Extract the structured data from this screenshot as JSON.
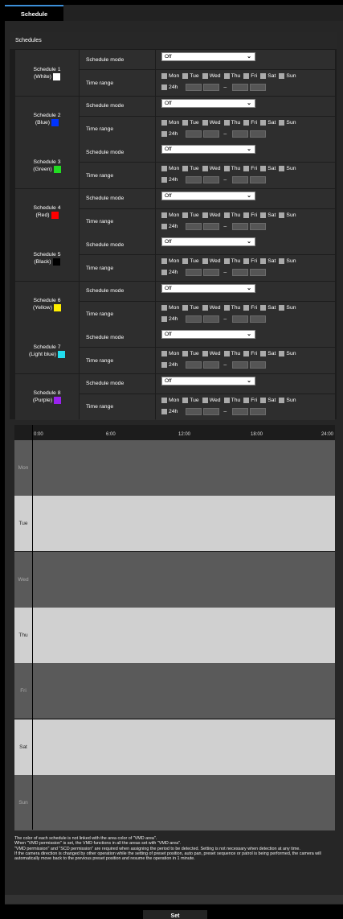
{
  "tab": {
    "label": "Schedule"
  },
  "section_title": "Schedules",
  "labels": {
    "mode": "Schedule mode",
    "time": "Time range",
    "h24": "24h",
    "dash": "–"
  },
  "mode_value": "Off",
  "days": [
    "Mon",
    "Tue",
    "Wed",
    "Thu",
    "Fri",
    "Sat",
    "Sun"
  ],
  "schedules": [
    {
      "title": "Schedule 1",
      "color_name": "(White)",
      "color": "#ffffff"
    },
    {
      "title": "Schedule 2",
      "color_name": "(Blue)",
      "color": "#0033ff"
    },
    {
      "title": "Schedule 3",
      "color_name": "(Green)",
      "color": "#22dd22"
    },
    {
      "title": "Schedule 4",
      "color_name": "(Red)",
      "color": "#ff0000"
    },
    {
      "title": "Schedule 5",
      "color_name": "(Black)",
      "color": "#000000"
    },
    {
      "title": "Schedule 6",
      "color_name": "(Yellow)",
      "color": "#ffee00"
    },
    {
      "title": "Schedule 7",
      "color_name": "(Light blue)",
      "color": "#22ddee"
    },
    {
      "title": "Schedule 8",
      "color_name": "(Purple)",
      "color": "#9922ee"
    }
  ],
  "timeline": {
    "hours": [
      "0:00",
      "6:00",
      "12:00",
      "18:00",
      "24:00"
    ],
    "rows": [
      {
        "day": "Mon",
        "fill": "#5a5a5a"
      },
      {
        "day": "Tue",
        "fill": "#d0d0d0"
      },
      {
        "day": "Wed",
        "fill": "#5a5a5a"
      },
      {
        "day": "Thu",
        "fill": "#d0d0d0"
      },
      {
        "day": "Fri",
        "fill": "#5a5a5a"
      },
      {
        "day": "Sat",
        "fill": "#d0d0d0"
      },
      {
        "day": "Sun",
        "fill": "#5a5a5a"
      }
    ]
  },
  "notes": [
    "The color of each schedule is not linked with the area color of \"VMD area\".",
    "When \"VMD permission\" is set, the VMD functions in all the areas set with \"VMD area\".",
    "\"VMD permission\" and \"SCD permission\" are required when assigning the period to be detected. Setting is not necessary when detection at any time.",
    "If the camera direction is changed by other operation while the setting of preset position, auto pan, preset sequence or patrol is being performed, the camera will automatically move back to the previous preset position and resume the operation in 1 minute."
  ],
  "set_button": "Set"
}
